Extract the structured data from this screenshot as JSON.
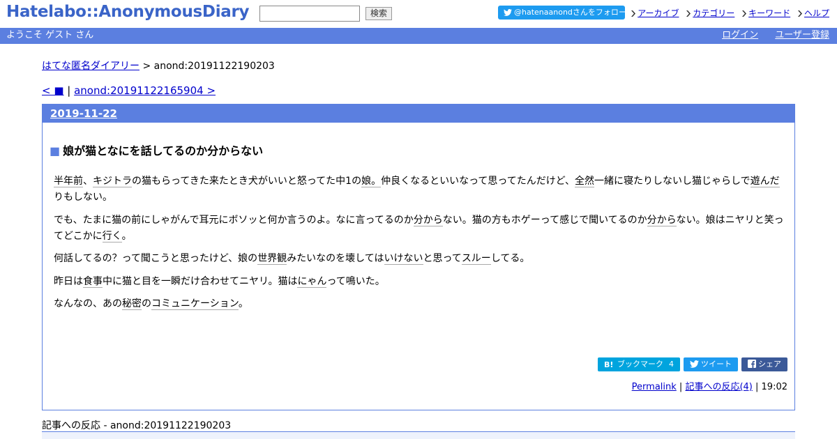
{
  "header": {
    "logo": "Hatelabo::AnonymousDiary",
    "search": {
      "value": "",
      "button_label": "検索"
    },
    "follow_label": "@hatenaanondさんをフォロー",
    "nav": [
      "アーカイブ",
      "カテゴリー",
      "キーワード",
      "ヘルプ"
    ]
  },
  "userbar": {
    "welcome": "ようこそ ゲスト さん",
    "login": "ログイン",
    "register": "ユーザー登録"
  },
  "breadcrumb": {
    "home": "はてな匿名ダイアリー",
    "separator": " > ",
    "current": "anond:20191122190203"
  },
  "pager": {
    "prev": "< ■",
    "separator": " | ",
    "next": "anond:20191122165904 >"
  },
  "day": {
    "date": "2019-11-22",
    "entry": {
      "anchor": "■",
      "title": "娘が猫となにを話してるのか分からない",
      "p1": {
        "s1": "半年前",
        "s2": "、",
        "s3": "キジトラ",
        "s4": "の猫もらってきた来たとき犬がいいと怒ってた中1の",
        "s5": "娘。",
        "s6": "仲良くなるといいなって思ってたんだけど、",
        "s7": "全然",
        "s8": "一緒に寝たりしないし猫じゃらしで",
        "s9": "遊んだ",
        "s10": "りもしない。"
      },
      "p2": {
        "s1": "でも、たまに猫の前にしゃがんで耳元にボソッと何か言うのよ。なに言ってるのか",
        "s2": "分から",
        "s3": "ない。猫の方もホゲーって感じで聞いてるのか",
        "s4": "分から",
        "s5": "ない。娘はニヤリと笑ってどこかに",
        "s6": "行く",
        "s7": "。"
      },
      "p3": {
        "s1": "何話してるの？って聞こうと思ったけど、娘の",
        "s2": "世界観",
        "s3": "みたいなのを壊しては",
        "s4": "いけない",
        "s5": "と思って",
        "s6": "スルー",
        "s7": "してる。"
      },
      "p4": {
        "s1": "昨日は",
        "s2": "食事",
        "s3": "中に猫と目を一瞬だけ合わせてニヤリ。猫は",
        "s4": "にゃん",
        "s5": "って鳴いた。"
      },
      "p5": {
        "s1": "なんなの、あの",
        "s2": "秘密",
        "s3": "の",
        "s4": "コミュニケーション",
        "s5": "。"
      }
    },
    "share": {
      "bookmark_label": "ブックマーク",
      "bookmark_count": "4",
      "tweet_label": "ツイート",
      "facebook_label": "シェア"
    },
    "footer": {
      "permalink": "Permalink",
      "separator": " | ",
      "reactions": "記事への反応(4)",
      "time": "19:02"
    }
  },
  "reactions_section": {
    "title": "記事への反応 - anond:20191122190203"
  }
}
